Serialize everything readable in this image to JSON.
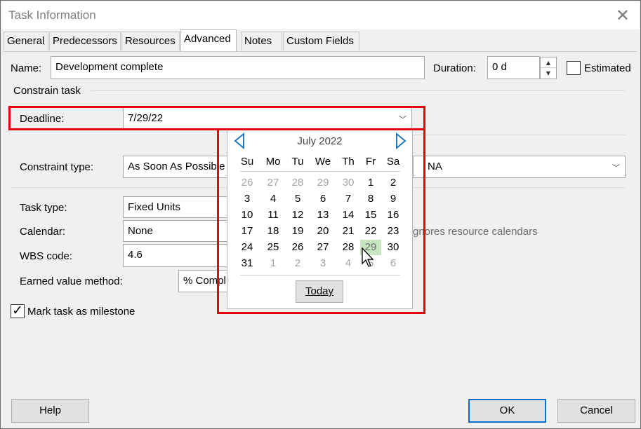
{
  "title": "Task Information",
  "tabs": [
    {
      "label": "General"
    },
    {
      "label": "Predecessors"
    },
    {
      "label": "Resources"
    },
    {
      "label": "Advanced"
    },
    {
      "label": "Notes"
    },
    {
      "label": "Custom Fields"
    }
  ],
  "active_tab": "Advanced",
  "name": {
    "label": "Name:",
    "value": "Development complete"
  },
  "duration": {
    "label": "Duration:",
    "value": "0 d"
  },
  "estimated": {
    "label": "Estimated",
    "checked": false
  },
  "constrain_section": "Constrain task",
  "deadline": {
    "label": "Deadline:",
    "value": "7/29/22"
  },
  "constraint_type": {
    "label": "Constraint type:",
    "value": "As Soon As Possible"
  },
  "constraint_date": {
    "value": "NA"
  },
  "task_type": {
    "label": "Task type:",
    "value": "Fixed Units"
  },
  "calendar": {
    "label": "Calendar:",
    "value": "None",
    "note": "Scheduling ignores resource calendars",
    "note_visible": "gnores resource calendars"
  },
  "wbs": {
    "label": "WBS code:",
    "value": "4.6"
  },
  "earned_value": {
    "label": "Earned value method:",
    "value": "% Complete",
    "value_visible": "% Compl"
  },
  "milestone": {
    "label": "Mark task as milestone",
    "checked": true
  },
  "buttons": {
    "help": "Help",
    "ok": "OK",
    "cancel": "Cancel"
  },
  "calendar_popup": {
    "month": "July 2022",
    "weekdays": [
      "Su",
      "Mo",
      "Tu",
      "We",
      "Th",
      "Fr",
      "Sa"
    ],
    "weeks": [
      [
        "26",
        "27",
        "28",
        "29",
        "30",
        "1",
        "2"
      ],
      [
        "3",
        "4",
        "5",
        "6",
        "7",
        "8",
        "9"
      ],
      [
        "10",
        "11",
        "12",
        "13",
        "14",
        "15",
        "16"
      ],
      [
        "17",
        "18",
        "19",
        "20",
        "21",
        "22",
        "23"
      ],
      [
        "24",
        "25",
        "26",
        "27",
        "28",
        "29",
        "30"
      ],
      [
        "31",
        "1",
        "2",
        "3",
        "4",
        "5",
        "6"
      ]
    ],
    "selected_day": "29",
    "today_label": "Today"
  },
  "colors": {
    "highlight": "#e3000f",
    "selected_day": "#c7e6c0",
    "nav_arrow": "#1f7ac0",
    "ok_border": "#0a6fc8"
  }
}
